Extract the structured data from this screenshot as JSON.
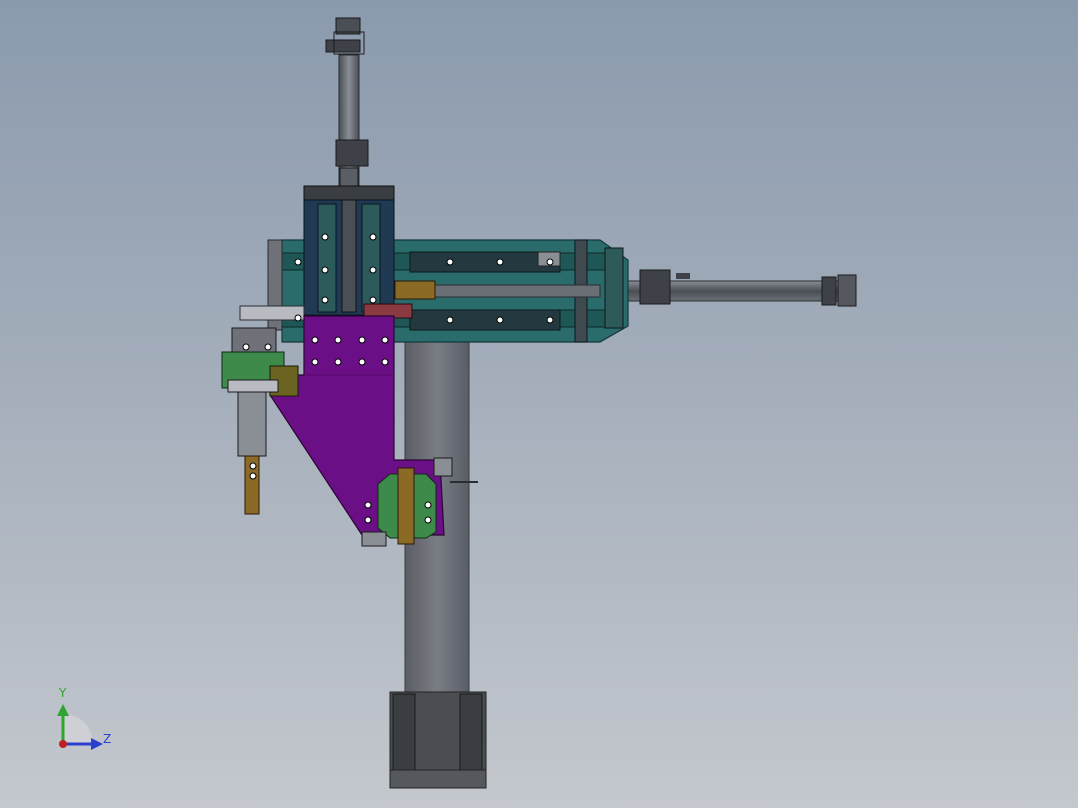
{
  "viewport": {
    "background_top": "#8b9aae",
    "background_bottom": "#c4c8ce"
  },
  "model": {
    "colors": {
      "teal": "#2a6b6b",
      "teal_dark": "#1f5656",
      "navy": "#1f3a52",
      "purple": "#6b0f86",
      "purple_dark": "#540a6a",
      "green": "#3d8a4a",
      "olive": "#6a6420",
      "bronze": "#8a6a25",
      "steel": "#6e7178",
      "steel_dark": "#3e4248",
      "steel_light": "#b8bcc2",
      "column": "#6a6d75",
      "red": "#8a3a40"
    }
  },
  "triad": {
    "y_label": "Y",
    "z_label": "Z",
    "y_color": "#2fa52f",
    "z_color": "#2a3fd0",
    "x_color": "#c02020"
  }
}
